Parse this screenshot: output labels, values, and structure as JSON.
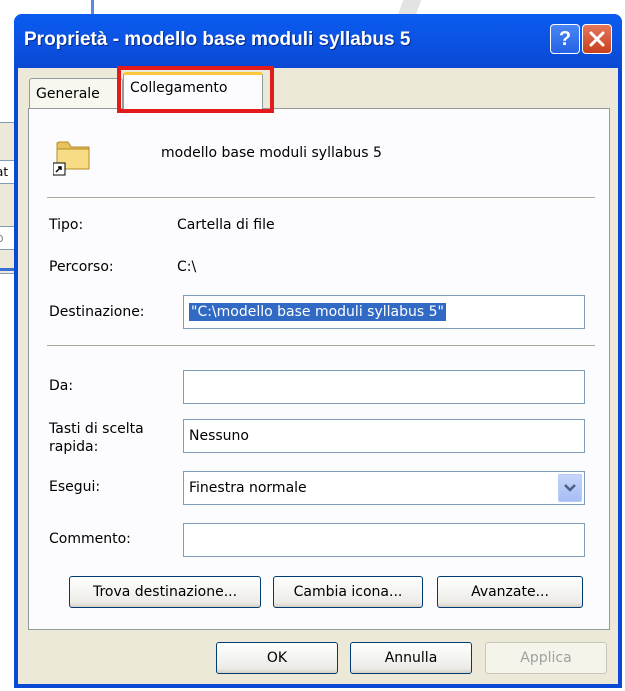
{
  "window": {
    "title": "Proprietà - modello base moduli syllabus 5"
  },
  "tabs": [
    {
      "label": "Generale",
      "active": false
    },
    {
      "label": "Collegamento",
      "active": true
    }
  ],
  "shortcut": {
    "name": "modello base moduli syllabus 5"
  },
  "fields": {
    "tipo": {
      "label": "Tipo:",
      "value": "Cartella di file"
    },
    "percorso": {
      "label": "Percorso:",
      "value": "C:\\"
    },
    "destinazione": {
      "label": "Destinazione:",
      "value": "\"C:\\modello base moduli syllabus 5\""
    },
    "da": {
      "label": "Da:",
      "value": ""
    },
    "tasti": {
      "label_line1": "Tasti di scelta",
      "label_line2": "rapida:",
      "value": "Nessuno"
    },
    "esegui": {
      "label": "Esegui:",
      "value": "Finestra normale"
    },
    "commento": {
      "label": "Commento:",
      "value": ""
    }
  },
  "buttons": {
    "trova": "Trova destinazione...",
    "cambia": "Cambia icona...",
    "avanzate": "Avanzate...",
    "ok": "OK",
    "annulla": "Annulla",
    "applica": "Applica"
  },
  "background": {
    "cell1": "at",
    "cell2": "p"
  },
  "colors": {
    "titlebar": "#0a5cf0",
    "highlight": "#e31b1b",
    "selection": "#316ac5"
  }
}
